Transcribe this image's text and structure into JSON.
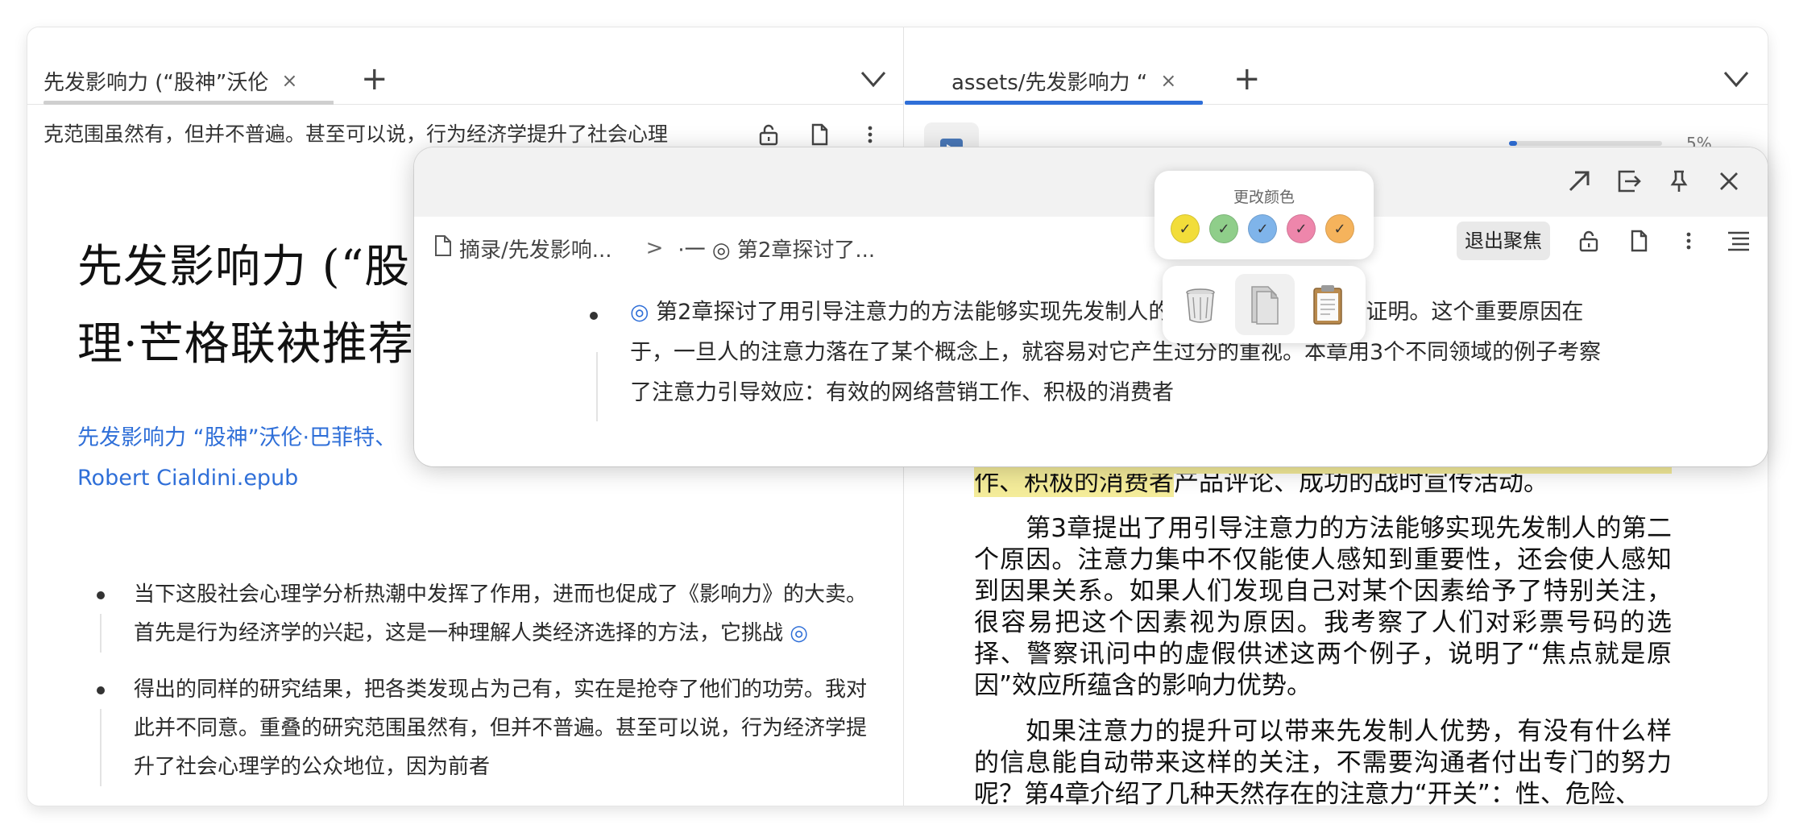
{
  "left_pane": {
    "tab": {
      "title": "先发影响力 (“股神”沃伦",
      "close": "×"
    },
    "tab_add": "+",
    "subbar_text": "克范围虽然有，但并不普遍。甚至可以说，行为经济学提升了社会心理",
    "doc_title": "先发影响力 (“股神”沃伦·巴菲特、查理·芒格联袂推荐",
    "doc_title_line1": "先发影响力 (“股",
    "doc_title_line2": "理·芒格联袂推荐",
    "doc_link_line1": "先发影响力 “股神”沃伦·巴菲特、",
    "doc_link_line2": "Robert Cialdini.epub",
    "bullets": [
      {
        "text": "当下这股社会心理学分析热潮中发挥了作用，进而也促成了《影响力》的大卖。首先是行为经济学的兴起，这是一种理解人类经济选择的方法，它挑战 ",
        "mark": "◎"
      },
      {
        "text": "得出的同样的研究结果，把各类发现占为己有，实在是抢夺了他们的功劳。我对此并不同意。重叠的研究范围虽然有，但并不普遍。甚至可以说，行为经济学提升了社会心理学的公众地位，因为前者",
        "mark": ""
      }
    ]
  },
  "right_pane": {
    "tab": {
      "title": "assets/先发影响力 “",
      "close": "×"
    },
    "tab_add": "+",
    "progress_percent": 5,
    "progress_label": "5%",
    "highlighted_text": "作、积极的消费者",
    "para1_rest": "产品评论、成功的战时宣传活动。",
    "para2": "第3章提出了用引导注意力的方法能够实现先发制人的第二个原因。注意力集中不仅能使人感知到重要性，还会使人感知到因果关系。如果人们发现自己对某个因素给予了特别关注，很容易把这个因素视为原因。我考察了人们对彩票号码的选择、警察讯问中的虚假供述这两个例子，说明了“焦点就是原因”效应所蕴含的影响力优势。",
    "para3": "如果注意力的提升可以带来先发制人优势，有没有什么样的信息能自动带来这样的关注，不需要沟通者付出专门的努力呢？第4章介绍了几种天然存在的注意力“开关”：性、危险、"
  },
  "popup": {
    "breadcrumb_doc": "摘录/先发影响...",
    "breadcrumb_sep": ">",
    "breadcrumb_block": "·一 ◎ 第2章探讨了...",
    "exit_focus": "退出聚焦",
    "mark": "◎",
    "text": " 第2章探讨了用引导注意力的方法能够实现先发制人的第一个原因，并加以证明。这个重要原因在于，一旦人的注意力落在了某个概念上，就容易对它产生过分的重视。本章用3个不同领域的例子考察了注意力引导效应：有效的网络营销工作、积极的消费者"
  },
  "color_picker": {
    "label": "更改颜色",
    "swatches": [
      {
        "name": "yellow",
        "color": "#f2dd3a",
        "check": "✓"
      },
      {
        "name": "green",
        "color": "#8fce8a",
        "check": "✓"
      },
      {
        "name": "blue",
        "color": "#7fb4ea",
        "check": "✓"
      },
      {
        "name": "pink",
        "color": "#ee86ab",
        "check": "✓"
      },
      {
        "name": "orange",
        "color": "#f5b35c",
        "check": "✓"
      }
    ]
  },
  "actions": [
    "trash-icon",
    "document-icon",
    "clipboard-icon"
  ],
  "colors": {
    "accent": "#2f6fd8",
    "highlight": "#f4ec9a"
  }
}
